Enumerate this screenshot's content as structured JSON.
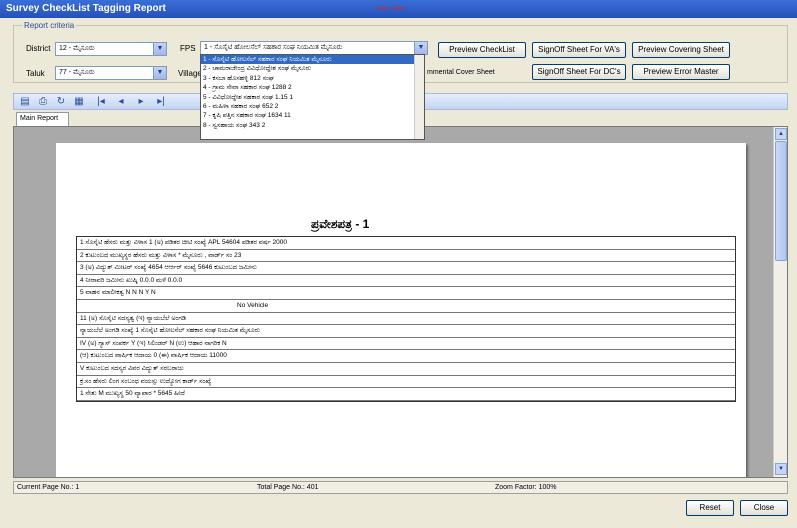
{
  "window": {
    "title": "Survey CheckList Tagging Report",
    "title_note": "ಸರ್ವೇ ವರದಿ"
  },
  "criteria": {
    "legend": "Report criteria",
    "district_label": "District",
    "district_value": "12 - ಮೈಸೂರು",
    "taluk_label": "Taluk",
    "taluk_value": "77 - ಮೈಸೂರು",
    "village_label": "Village",
    "fps_label": "FPS",
    "fps_value": "1 - ಸೊಸೈಟಿ ಹೋಲಸೆಲ್ ಸಹಕಾರ ಸಂಘ ನಿಯಮಿತ ಮೈಸೂರು",
    "env_cover_label": "mmental Cover Sheet"
  },
  "buttons": {
    "preview_checklist": "Preview CheckList",
    "signoff_va": "SignOff Sheet For VA's",
    "preview_cover": "Preview Covering Sheet",
    "signoff_dc": "SignOff Sheet For DC's",
    "preview_error": "Preview Error Master",
    "reset": "Reset",
    "close": "Close"
  },
  "fps_options": [
    "1 - ಸೊಸೈಟಿ ಹೋಲಸೆಲ್ ಸಹಕಾರ ಸಂಘ ನಿಯಮಿತ ಮೈಸೂರು",
    "2 - ಚಾಮರಾಜೇಂದ್ರ ವಿವಿಧೋದ್ದೇಶ ಸಂಘ ಮೈಸೂರು",
    "3 - ಕಸಬಾ ಹೊಸಹಳ್ಳಿ 812 ಸಂಘ",
    "4 - ಗ್ರಾಮ ಸೇವಾ ಸಹಕಾರ ಸಂಘ 1288 2",
    "5 - ವಿವಿಧೋದ್ದೇಶ ಸಹಕಾರ ಸಂಘ 1.15 1",
    "6 - ಮಹಿಳಾ ಸಹಕಾರ ಸಂಘ 652 2",
    "7 - ಕೃಷಿ ಪತ್ತಿನ ಸಹಕಾರ ಸಂಘ 1634 11",
    "8 - ಸ್ವಸಹಾಯ ಸಂಘ 343 2"
  ],
  "report": {
    "tab": "Main Report",
    "form_title": "ಪ್ರವೇಶಪತ್ರ - 1",
    "rows": [
      "1 ಸೊಸೈಟಿ ಹೆಸರು ಮತ್ತು ವಿಳಾಸ     1 (ಅ) ಪಡಿತರ ಚೀಟಿ ಸಂಖ್ಯೆ   APL 54604     ಪಡಿತರ ವರ್ಷ   2000",
      "2 ಕುಟುಂಬದ ಮುಖ್ಯಸ್ಥರ ಹೆಸರು ಮತ್ತು ವಿಳಾಸ * ಮೈಸೂರು  , ವಾರ್ಡ್ ಸಂ 23",
      "3 (ಅ) ವಿದ್ಯುತ್ ಮೀಟರ್ ಸಂಖ್ಯೆ  4654   ಆರ್ಆರ್ ಸಂಖ್ಯೆ 5646   ಕುಟುಂಬದ ಜಮೀನು",
      "4 ನೀರಾವರಿ ಜಮೀನು   ಖುಷ್ಕಿ  0.0.0   ಮಳೆ 0.0.0",
      "5 ವಾಹನ ಮಾಲೀಕತ್ವ  N   N   N   Y   N",
      "No Vehicle",
      "11 (ಅ) ಸೊಸೈಟಿ ಸದಸ್ಯತ್ವ   (ಇ) ನ್ಯಾಯಬೆಲೆ ಅಂಗಡಿ",
      "ನ್ಯಾಯಬೆಲೆ ಅಂಗಡಿ ಸಂಖ್ಯೆ  1  ಸೊಸೈಟಿ ಹೋಲಸೆಲ್ ಸಹಕಾರ ಸಂಘ ನಿಯಮಿತ ಮೈಸೂರು",
      "IV (ಅ) ಗ್ಯಾಸ್ ಸಂಪರ್ಕ  Y   (ಇ) ಸಿಲಿಂಡರ್  N   (ಉ) ಆಹಾರ ನಾಗರಿಕ  N",
      "(ಆ) ಕುಟುಂಬದ ವಾರ್ಷಿಕ ಆದಾಯ  0   (ಈ) ವಾರ್ಷಿಕ ಆದಾಯ  11000",
      "V ಕುಟುಂಬದ ಸದಸ್ಯರ ವಿವರ   ವಿದ್ಯುತ್ ಸರಬರಾಜು",
      "ಕ್ರ.ಸಂ  ಹೆಸರು  ಲಿಂಗ  ಸಂಬಂಧ  ವಯಸ್ಸು  ಉದ್ಯೋಗ  ಕಾರ್ಡ್  ಸಂಖ್ಯೆ",
      "1  ಸೇತು   M  ಮುಖ್ಯಸ್ಥ   50  ವ್ಯಾಪಾರ   *   5645  ಹೀದೆ"
    ]
  },
  "status": {
    "current_page": "Current Page No.: 1",
    "total_page": "Total Page No.: 401",
    "zoom": "Zoom Factor: 100%"
  }
}
